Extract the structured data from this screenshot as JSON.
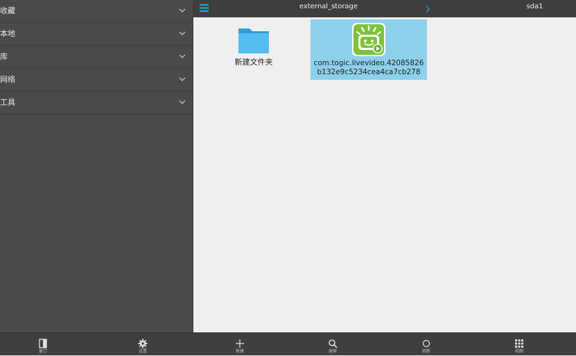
{
  "sidebar": {
    "items": [
      {
        "label": "收藏"
      },
      {
        "label": "本地"
      },
      {
        "label": "库"
      },
      {
        "label": "网络"
      },
      {
        "label": "工具"
      }
    ]
  },
  "header": {
    "title": "external_storage",
    "crumb": "sda1"
  },
  "files": [
    {
      "name": "新建文件夹",
      "type": "folder-icon"
    },
    {
      "name": "com.togic.livevideo.42085826b132e9c5234cea4ca7cb278",
      "type": "app-icon",
      "selected": true
    }
  ],
  "bottom_bar": {
    "panel": "窗口",
    "settings": "设置",
    "new": "新建",
    "search": "搜索",
    "refresh": "刷新",
    "view": "视图"
  },
  "colors": {
    "sidebar_bg": "#4a4a4a",
    "header_bg": "#3e3e3e",
    "accent": "#2aa3dc",
    "selection": "#8cd0ec",
    "app_icon_green": "#7cc33b"
  }
}
